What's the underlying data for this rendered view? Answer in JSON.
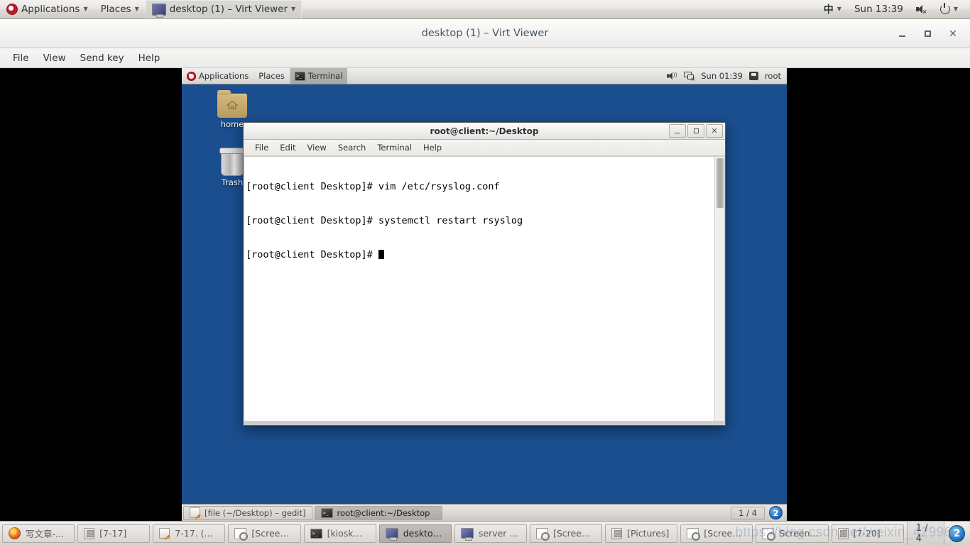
{
  "host_panel": {
    "logo_icon": "fedora-logo",
    "applications": "Applications",
    "places": "Places",
    "active_window": "desktop (1) – Virt Viewer",
    "ime": "中",
    "clock": "Sun 13:39",
    "volume_icon": "speaker-muted-icon",
    "power_icon": "power-icon"
  },
  "virt_viewer": {
    "title": "desktop (1) – Virt Viewer",
    "menu": [
      "File",
      "View",
      "Send key",
      "Help"
    ],
    "window_buttons": {
      "minimize": "–",
      "maximize": "□",
      "close": "×"
    }
  },
  "vm": {
    "panel": {
      "applications": "Applications",
      "places": "Places",
      "window_button": "Terminal",
      "clock": "Sun 01:39",
      "user": "root"
    },
    "desktop_icons": [
      {
        "label": "home",
        "icon": "home-folder-icon"
      },
      {
        "label": "Trash",
        "icon": "trash-icon"
      }
    ],
    "terminal": {
      "title": "root@client:~/Desktop",
      "menu": [
        "File",
        "Edit",
        "View",
        "Search",
        "Terminal",
        "Help"
      ],
      "lines": [
        "[root@client Desktop]# vim /etc/rsyslog.conf",
        "[root@client Desktop]# systemctl restart rsyslog",
        "[root@client Desktop]# "
      ],
      "background": "#ffffff",
      "foreground": "#000000"
    },
    "taskbar": {
      "tasks": [
        {
          "label": "[file (~/Desktop) – gedit]",
          "icon": "gedit-icon",
          "active": false
        },
        {
          "label": "root@client:~/Desktop",
          "icon": "terminal-icon",
          "active": true
        }
      ],
      "workspace_count": "1 / 4",
      "workspace_badge": "2"
    }
  },
  "host_taskbar": {
    "tasks": [
      {
        "label": "写文章-...",
        "icon": "firefox-icon",
        "active": false
      },
      {
        "label": "[7-17]",
        "icon": "file-manager-icon",
        "active": false
      },
      {
        "label": "7-17. (...",
        "icon": "gedit-icon",
        "active": false
      },
      {
        "label": "[Screens...",
        "icon": "screenshot-icon",
        "active": false
      },
      {
        "label": "[kiosk@...",
        "icon": "terminal-icon",
        "active": false
      },
      {
        "label": "desktop...",
        "icon": "monitor-icon",
        "active": true
      },
      {
        "label": "server (...",
        "icon": "monitor-icon",
        "active": false
      },
      {
        "label": "[Screens...",
        "icon": "screenshot-icon",
        "active": false
      },
      {
        "label": "[Pictures]",
        "icon": "file-manager-icon",
        "active": false
      },
      {
        "label": "[Screens...",
        "icon": "screenshot-icon",
        "active": false
      },
      {
        "label": "Screens...",
        "icon": "screenshot-icon",
        "active": false
      },
      {
        "label": "[7-20]",
        "icon": "file-manager-icon",
        "active": false
      }
    ],
    "workspace_count": "1 / 4",
    "workspace_badge": "2"
  },
  "watermark": "https://blog.csdn.net/weixin_42996…"
}
